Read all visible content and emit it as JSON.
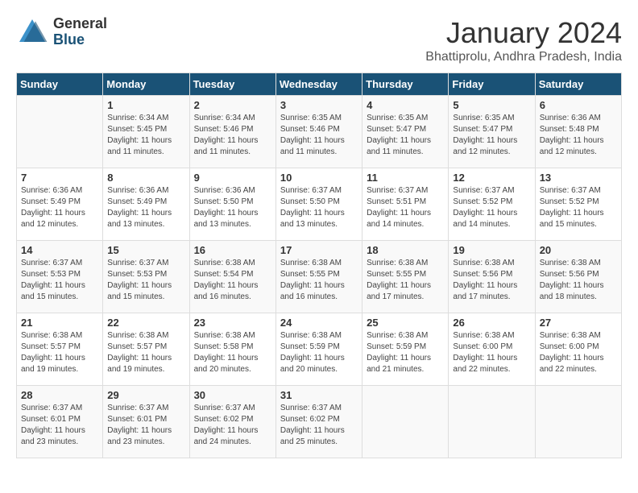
{
  "logo": {
    "general": "General",
    "blue": "Blue"
  },
  "title": "January 2024",
  "location": "Bhattiprolu, Andhra Pradesh, India",
  "days_of_week": [
    "Sunday",
    "Monday",
    "Tuesday",
    "Wednesday",
    "Thursday",
    "Friday",
    "Saturday"
  ],
  "weeks": [
    [
      {
        "day": "",
        "sunrise": "",
        "sunset": "",
        "daylight": ""
      },
      {
        "day": "1",
        "sunrise": "Sunrise: 6:34 AM",
        "sunset": "Sunset: 5:45 PM",
        "daylight": "Daylight: 11 hours and 11 minutes."
      },
      {
        "day": "2",
        "sunrise": "Sunrise: 6:34 AM",
        "sunset": "Sunset: 5:46 PM",
        "daylight": "Daylight: 11 hours and 11 minutes."
      },
      {
        "day": "3",
        "sunrise": "Sunrise: 6:35 AM",
        "sunset": "Sunset: 5:46 PM",
        "daylight": "Daylight: 11 hours and 11 minutes."
      },
      {
        "day": "4",
        "sunrise": "Sunrise: 6:35 AM",
        "sunset": "Sunset: 5:47 PM",
        "daylight": "Daylight: 11 hours and 11 minutes."
      },
      {
        "day": "5",
        "sunrise": "Sunrise: 6:35 AM",
        "sunset": "Sunset: 5:47 PM",
        "daylight": "Daylight: 11 hours and 12 minutes."
      },
      {
        "day": "6",
        "sunrise": "Sunrise: 6:36 AM",
        "sunset": "Sunset: 5:48 PM",
        "daylight": "Daylight: 11 hours and 12 minutes."
      }
    ],
    [
      {
        "day": "7",
        "sunrise": "Sunrise: 6:36 AM",
        "sunset": "Sunset: 5:49 PM",
        "daylight": "Daylight: 11 hours and 12 minutes."
      },
      {
        "day": "8",
        "sunrise": "Sunrise: 6:36 AM",
        "sunset": "Sunset: 5:49 PM",
        "daylight": "Daylight: 11 hours and 13 minutes."
      },
      {
        "day": "9",
        "sunrise": "Sunrise: 6:36 AM",
        "sunset": "Sunset: 5:50 PM",
        "daylight": "Daylight: 11 hours and 13 minutes."
      },
      {
        "day": "10",
        "sunrise": "Sunrise: 6:37 AM",
        "sunset": "Sunset: 5:50 PM",
        "daylight": "Daylight: 11 hours and 13 minutes."
      },
      {
        "day": "11",
        "sunrise": "Sunrise: 6:37 AM",
        "sunset": "Sunset: 5:51 PM",
        "daylight": "Daylight: 11 hours and 14 minutes."
      },
      {
        "day": "12",
        "sunrise": "Sunrise: 6:37 AM",
        "sunset": "Sunset: 5:52 PM",
        "daylight": "Daylight: 11 hours and 14 minutes."
      },
      {
        "day": "13",
        "sunrise": "Sunrise: 6:37 AM",
        "sunset": "Sunset: 5:52 PM",
        "daylight": "Daylight: 11 hours and 15 minutes."
      }
    ],
    [
      {
        "day": "14",
        "sunrise": "Sunrise: 6:37 AM",
        "sunset": "Sunset: 5:53 PM",
        "daylight": "Daylight: 11 hours and 15 minutes."
      },
      {
        "day": "15",
        "sunrise": "Sunrise: 6:37 AM",
        "sunset": "Sunset: 5:53 PM",
        "daylight": "Daylight: 11 hours and 15 minutes."
      },
      {
        "day": "16",
        "sunrise": "Sunrise: 6:38 AM",
        "sunset": "Sunset: 5:54 PM",
        "daylight": "Daylight: 11 hours and 16 minutes."
      },
      {
        "day": "17",
        "sunrise": "Sunrise: 6:38 AM",
        "sunset": "Sunset: 5:55 PM",
        "daylight": "Daylight: 11 hours and 16 minutes."
      },
      {
        "day": "18",
        "sunrise": "Sunrise: 6:38 AM",
        "sunset": "Sunset: 5:55 PM",
        "daylight": "Daylight: 11 hours and 17 minutes."
      },
      {
        "day": "19",
        "sunrise": "Sunrise: 6:38 AM",
        "sunset": "Sunset: 5:56 PM",
        "daylight": "Daylight: 11 hours and 17 minutes."
      },
      {
        "day": "20",
        "sunrise": "Sunrise: 6:38 AM",
        "sunset": "Sunset: 5:56 PM",
        "daylight": "Daylight: 11 hours and 18 minutes."
      }
    ],
    [
      {
        "day": "21",
        "sunrise": "Sunrise: 6:38 AM",
        "sunset": "Sunset: 5:57 PM",
        "daylight": "Daylight: 11 hours and 19 minutes."
      },
      {
        "day": "22",
        "sunrise": "Sunrise: 6:38 AM",
        "sunset": "Sunset: 5:57 PM",
        "daylight": "Daylight: 11 hours and 19 minutes."
      },
      {
        "day": "23",
        "sunrise": "Sunrise: 6:38 AM",
        "sunset": "Sunset: 5:58 PM",
        "daylight": "Daylight: 11 hours and 20 minutes."
      },
      {
        "day": "24",
        "sunrise": "Sunrise: 6:38 AM",
        "sunset": "Sunset: 5:59 PM",
        "daylight": "Daylight: 11 hours and 20 minutes."
      },
      {
        "day": "25",
        "sunrise": "Sunrise: 6:38 AM",
        "sunset": "Sunset: 5:59 PM",
        "daylight": "Daylight: 11 hours and 21 minutes."
      },
      {
        "day": "26",
        "sunrise": "Sunrise: 6:38 AM",
        "sunset": "Sunset: 6:00 PM",
        "daylight": "Daylight: 11 hours and 22 minutes."
      },
      {
        "day": "27",
        "sunrise": "Sunrise: 6:38 AM",
        "sunset": "Sunset: 6:00 PM",
        "daylight": "Daylight: 11 hours and 22 minutes."
      }
    ],
    [
      {
        "day": "28",
        "sunrise": "Sunrise: 6:37 AM",
        "sunset": "Sunset: 6:01 PM",
        "daylight": "Daylight: 11 hours and 23 minutes."
      },
      {
        "day": "29",
        "sunrise": "Sunrise: 6:37 AM",
        "sunset": "Sunset: 6:01 PM",
        "daylight": "Daylight: 11 hours and 23 minutes."
      },
      {
        "day": "30",
        "sunrise": "Sunrise: 6:37 AM",
        "sunset": "Sunset: 6:02 PM",
        "daylight": "Daylight: 11 hours and 24 minutes."
      },
      {
        "day": "31",
        "sunrise": "Sunrise: 6:37 AM",
        "sunset": "Sunset: 6:02 PM",
        "daylight": "Daylight: 11 hours and 25 minutes."
      },
      {
        "day": "",
        "sunrise": "",
        "sunset": "",
        "daylight": ""
      },
      {
        "day": "",
        "sunrise": "",
        "sunset": "",
        "daylight": ""
      },
      {
        "day": "",
        "sunrise": "",
        "sunset": "",
        "daylight": ""
      }
    ]
  ]
}
